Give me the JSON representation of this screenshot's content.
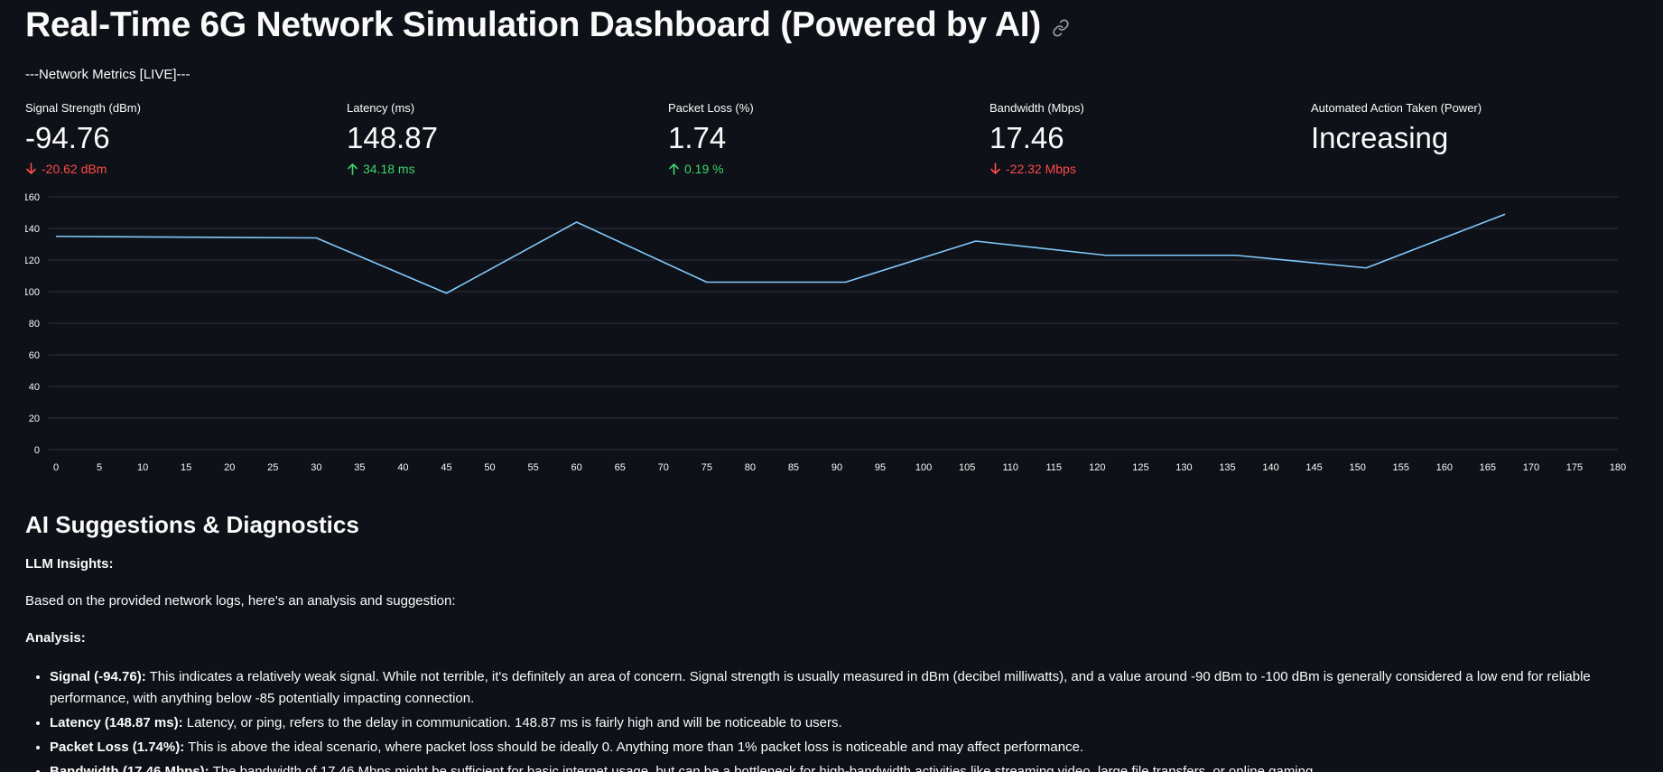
{
  "header": {
    "title": "Real-Time 6G Network Simulation Dashboard (Powered by AI)",
    "link_icon": "link-icon"
  },
  "metrics_section": {
    "label": "---Network Metrics [LIVE]---"
  },
  "metrics": [
    {
      "label": "Signal Strength (dBm)",
      "value": "-94.76",
      "delta": "-20.62 dBm",
      "direction": "down"
    },
    {
      "label": "Latency (ms)",
      "value": "148.87",
      "delta": "34.18 ms",
      "direction": "up"
    },
    {
      "label": "Packet Loss (%)",
      "value": "1.74",
      "delta": "0.19 %",
      "direction": "up"
    },
    {
      "label": "Bandwidth (Mbps)",
      "value": "17.46",
      "delta": "-22.32 Mbps",
      "direction": "down"
    },
    {
      "label": "Automated Action Taken (Power)",
      "value": "Increasing",
      "delta": "",
      "direction": "none"
    }
  ],
  "colors": {
    "background": "#0e1117",
    "delta_down": "#ff4b4b",
    "delta_up": "#3dd56d",
    "line": "#83c9ff",
    "grid": "#31333f"
  },
  "chart_data": {
    "type": "line",
    "x": [
      0,
      30,
      45,
      60,
      75,
      91,
      106,
      121,
      136,
      151,
      167
    ],
    "series": [
      {
        "values": [
          135,
          134,
          99,
          144,
          106,
          106,
          132,
          123,
          123,
          115,
          149
        ]
      }
    ],
    "xlim": [
      0,
      180
    ],
    "ylim": [
      0,
      160
    ],
    "xticks": [
      0,
      5,
      10,
      15,
      20,
      25,
      30,
      35,
      40,
      45,
      50,
      55,
      60,
      65,
      70,
      75,
      80,
      85,
      90,
      95,
      100,
      105,
      110,
      115,
      120,
      125,
      130,
      135,
      140,
      145,
      150,
      155,
      160,
      165,
      170,
      175,
      180
    ],
    "yticks": [
      0,
      20,
      40,
      60,
      80,
      100,
      120,
      140,
      160
    ],
    "grid": true
  },
  "ai": {
    "heading": "AI Suggestions & Diagnostics",
    "insights_label": "LLM Insights:",
    "intro": "Based on the provided network logs, here's an analysis and suggestion:",
    "analysis_label": "Analysis:",
    "findings": [
      {
        "title": "Signal (-94.76):",
        "text": " This indicates a relatively weak signal. While not terrible, it's definitely an area of concern. Signal strength is usually measured in dBm (decibel milliwatts), and a value around -90 dBm to -100 dBm is generally considered a low end for reliable performance, with anything below -85 potentially impacting connection."
      },
      {
        "title": "Latency (148.87 ms):",
        "text": " Latency, or ping, refers to the delay in communication. 148.87 ms is fairly high and will be noticeable to users."
      },
      {
        "title": "Packet Loss (1.74%):",
        "text": " This is above the ideal scenario, where packet loss should be ideally 0. Anything more than 1% packet loss is noticeable and may affect performance."
      },
      {
        "title": "Bandwidth (17.46 Mbps):",
        "text": " The bandwidth of 17.46 Mbps might be sufficient for basic internet usage, but can be a bottleneck for high-bandwidth activities like streaming video, large file transfers, or online gaming."
      }
    ]
  }
}
